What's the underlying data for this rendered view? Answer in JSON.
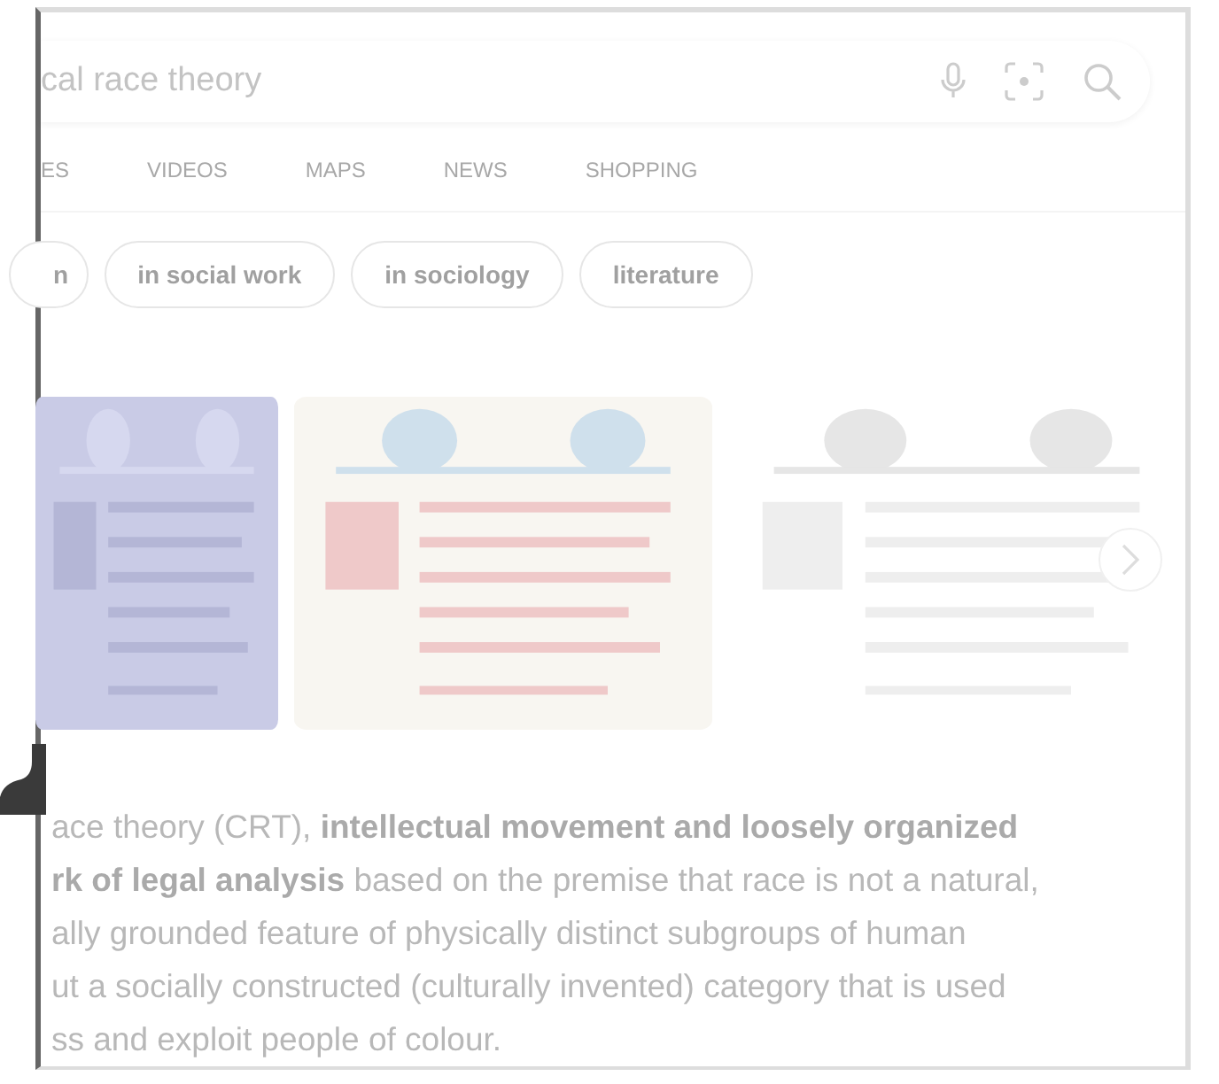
{
  "search": {
    "value": "cal race theory"
  },
  "tabs": [
    "ES",
    "VIDEOS",
    "MAPS",
    "NEWS",
    "SHOPPING"
  ],
  "chips": [
    "n",
    "in social work",
    "in sociology",
    "literature"
  ],
  "images": [
    {
      "kind": "picture"
    },
    {
      "kind": "picture"
    },
    {
      "kind": "picture"
    }
  ],
  "summary": [
    "ace theory (CRT), **intellectual movement and loosely organized**",
    "**rk of legal analysis** based on the premise that race is not a natural,",
    "ally grounded feature of physically distinct subgroups of human",
    "ut a socially constructed (culturally invented) category that is used",
    "ss and exploit people of colour."
  ]
}
